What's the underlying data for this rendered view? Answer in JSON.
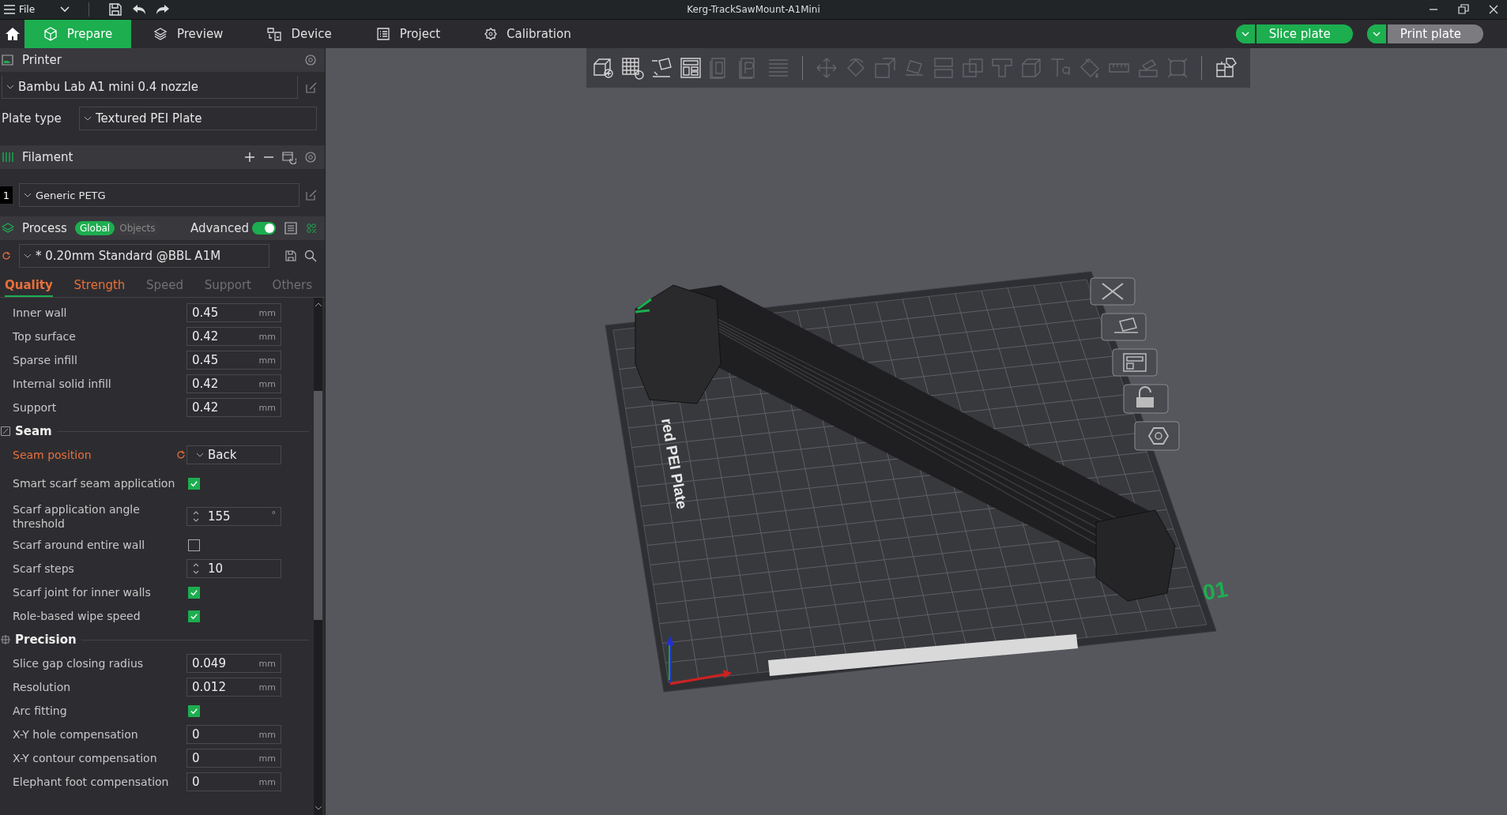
{
  "titlebar": {
    "menu": "File",
    "title": "Kerg-TrackSawMount-A1Mini"
  },
  "tabs": [
    {
      "label": "Prepare",
      "selected": true
    },
    {
      "label": "Preview",
      "selected": false
    },
    {
      "label": "Device",
      "selected": false
    },
    {
      "label": "Project",
      "selected": false
    },
    {
      "label": "Calibration",
      "selected": false
    }
  ],
  "actions": [
    {
      "label": "Slice plate",
      "kind": "primary"
    },
    {
      "label": "Print plate",
      "kind": "secondary"
    }
  ],
  "printer": {
    "title": "Printer",
    "preset": "Bambu Lab A1 mini 0.4 nozzle",
    "plate_label": "Plate type",
    "plate_value": "Textured PEI Plate"
  },
  "filament": {
    "title": "Filament",
    "items": [
      {
        "index": "1",
        "name": "Generic PETG"
      }
    ]
  },
  "process": {
    "title": "Process",
    "scopes": [
      {
        "label": "Global",
        "selected": true
      },
      {
        "label": "Objects",
        "selected": false
      }
    ],
    "advanced": {
      "label": "Advanced",
      "on": true
    },
    "preset": "* 0.20mm Standard @BBL A1M"
  },
  "setting_tabs": [
    {
      "label": "Quality",
      "selected": true,
      "modified": true
    },
    {
      "label": "Strength",
      "selected": false,
      "modified": true
    },
    {
      "label": "Speed",
      "selected": false,
      "modified": false
    },
    {
      "label": "Support",
      "selected": false,
      "modified": false
    },
    {
      "label": "Others",
      "selected": false,
      "modified": false
    }
  ],
  "groups": [
    {
      "rows": [
        {
          "label": "Inner wall",
          "kind": "number",
          "value": "0.45",
          "unit": "mm",
          "modified": false
        },
        {
          "label": "Top surface",
          "kind": "number",
          "value": "0.42",
          "unit": "mm",
          "modified": false
        },
        {
          "label": "Sparse infill",
          "kind": "number",
          "value": "0.45",
          "unit": "mm",
          "modified": false
        },
        {
          "label": "Internal solid infill",
          "kind": "number",
          "value": "0.42",
          "unit": "mm",
          "modified": false
        },
        {
          "label": "Support",
          "kind": "number",
          "value": "0.42",
          "unit": "mm",
          "modified": false
        }
      ]
    },
    {
      "title": "Seam",
      "rows": [
        {
          "label": "Seam position",
          "kind": "dropdown",
          "value": "Back",
          "modified": true
        },
        {
          "label": "Smart scarf seam application",
          "kind": "checkbox",
          "checked": true,
          "modified": false
        },
        {
          "label": "Scarf application angle threshold",
          "kind": "spin",
          "value": "155",
          "unit": "°",
          "modified": false
        },
        {
          "label": "Scarf around entire wall",
          "kind": "checkbox",
          "checked": false,
          "modified": false
        },
        {
          "label": "Scarf steps",
          "kind": "spin",
          "value": "10",
          "modified": false
        },
        {
          "label": "Scarf joint for inner walls",
          "kind": "checkbox",
          "checked": true,
          "modified": false
        },
        {
          "label": "Role-based wipe speed",
          "kind": "checkbox",
          "checked": true,
          "modified": false
        }
      ]
    },
    {
      "title": "Precision",
      "rows": [
        {
          "label": "Slice gap closing radius",
          "kind": "number",
          "value": "0.049",
          "unit": "mm",
          "modified": false
        },
        {
          "label": "Resolution",
          "kind": "number",
          "value": "0.012",
          "unit": "mm",
          "modified": false
        },
        {
          "label": "Arc fitting",
          "kind": "checkbox",
          "checked": true,
          "modified": false
        },
        {
          "label": "X-Y hole compensation",
          "kind": "number",
          "value": "0",
          "unit": "mm",
          "modified": false
        },
        {
          "label": "X-Y contour compensation",
          "kind": "number",
          "value": "0",
          "unit": "mm",
          "modified": false
        },
        {
          "label": "Elephant foot compensation",
          "kind": "number",
          "value": "0",
          "unit": "mm",
          "modified": false
        }
      ]
    }
  ],
  "scene": {
    "plate_text": "red PEI Plate",
    "plate_number": "01"
  }
}
